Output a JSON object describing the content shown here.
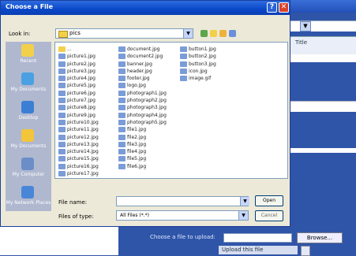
{
  "dialog": {
    "title": "Choose a File",
    "help_label": "?",
    "close_label": "✕",
    "look_in_label": "Look in:",
    "look_in_value": "pics",
    "places": [
      {
        "label": "Recent",
        "icon": "recent-documents-icon",
        "color": "#f2d04a"
      },
      {
        "label": "My Documents",
        "icon": "my-documents-icon",
        "color": "#4aa0e0"
      },
      {
        "label": "Desktop",
        "icon": "desktop-icon",
        "color": "#3b7fd4"
      },
      {
        "label": "My Documents",
        "icon": "folder-open-icon",
        "color": "#f2c53a"
      },
      {
        "label": "My Computer",
        "icon": "my-computer-icon",
        "color": "#6c8ec8"
      },
      {
        "label": "My Network Places",
        "icon": "network-places-icon",
        "color": "#4a86d8"
      }
    ],
    "files": {
      "col1": [
        "...",
        "picture1.jpg",
        "picture2.jpg",
        "picture3.jpg",
        "picture4.jpg",
        "picture5.jpg",
        "picture6.jpg",
        "picture7.jpg",
        "picture8.jpg",
        "picture9.jpg",
        "picture10.jpg",
        "picture11.jpg",
        "picture12.jpg",
        "picture13.jpg",
        "picture14.jpg",
        "picture15.jpg",
        "picture16.jpg",
        "picture17.jpg"
      ],
      "col2": [
        "document.jpg",
        "document2.jpg",
        "banner.jpg",
        "header.jpg",
        "footer.jpg",
        "logo.jpg",
        "photograph1.jpg",
        "photograph2.jpg",
        "photograph3.jpg",
        "photograph4.jpg",
        "photograph5.jpg",
        "file1.jpg",
        "file2.jpg",
        "file3.jpg",
        "file4.jpg",
        "file5.jpg",
        "file6.jpg"
      ],
      "col3": [
        "button1.jpg",
        "button2.jpg",
        "button3.jpg",
        "icon.jpg",
        "image.gif"
      ]
    },
    "file_name_label": "File name:",
    "file_name_value": "",
    "files_of_type_label": "Files of type:",
    "files_of_type_value": "All Files (*.*)",
    "open_label": "Open",
    "cancel_label": "Cancel"
  },
  "background": {
    "header_text": "Title",
    "file_label": "Choose a file to upload:",
    "browse_label": "Browse...",
    "link_text": "Upload this file"
  }
}
